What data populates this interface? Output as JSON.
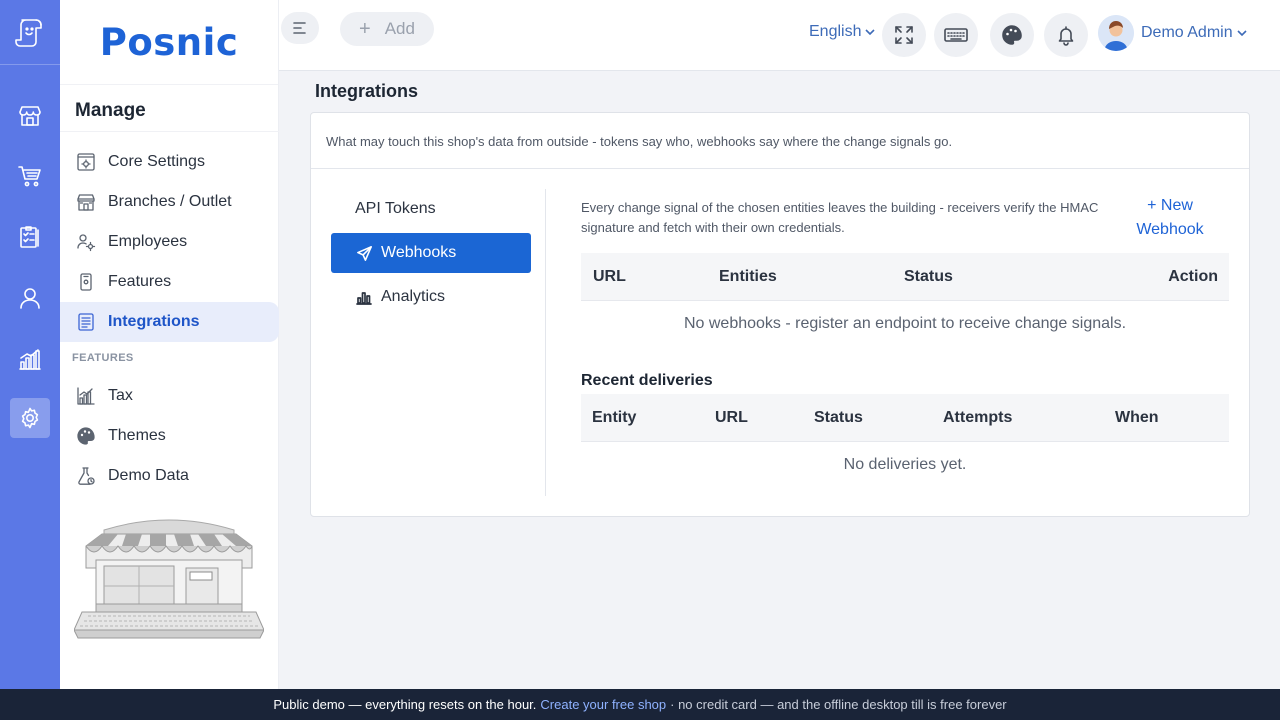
{
  "brand": {
    "name": "Posnic"
  },
  "rail": {
    "items": [
      {
        "icon": "store-icon"
      },
      {
        "icon": "cart-icon"
      },
      {
        "icon": "clipboard-icon"
      },
      {
        "icon": "user-icon"
      },
      {
        "icon": "chart-icon"
      },
      {
        "icon": "gear-icon",
        "active": true
      }
    ]
  },
  "sidebar": {
    "title": "Manage",
    "items": [
      {
        "label": "Core Settings",
        "icon": "settings-doc-icon"
      },
      {
        "label": "Branches / Outlet",
        "icon": "store-icon"
      },
      {
        "label": "Employees",
        "icon": "people-gear-icon"
      },
      {
        "label": "Features",
        "icon": "phone-icon"
      },
      {
        "label": "Integrations",
        "icon": "list-doc-icon",
        "active": true
      }
    ],
    "section_label": "FEATURES",
    "feature_items": [
      {
        "label": "Tax",
        "icon": "chart-icon"
      },
      {
        "label": "Themes",
        "icon": "palette-icon"
      },
      {
        "label": "Demo Data",
        "icon": "flask-icon"
      }
    ]
  },
  "topbar": {
    "add_label": "Add",
    "language": "English",
    "user_name": "Demo Admin",
    "icons": [
      "expand-icon",
      "keyboard-icon",
      "palette-icon",
      "bell-icon"
    ]
  },
  "main": {
    "title": "Integrations",
    "description": "What may touch this shop's data from outside - tokens say who, webhooks say where the change signals go.",
    "tabs": [
      {
        "label": "API Tokens"
      },
      {
        "label": "Webhooks",
        "active": true,
        "icon": "send-icon"
      },
      {
        "label": "Analytics",
        "icon": "bar-chart-icon"
      }
    ],
    "webhooks": {
      "description": "Every change signal of the chosen entities leaves the building - receivers verify the HMAC signature and fetch with their own credentials.",
      "new_button": "+ New Webhook",
      "columns": [
        "URL",
        "Entities",
        "Status",
        "Action"
      ],
      "empty": "No webhooks - register an endpoint to receive change signals."
    },
    "deliveries": {
      "title": "Recent deliveries",
      "columns": [
        "Entity",
        "URL",
        "Status",
        "Attempts",
        "When"
      ],
      "empty": "No deliveries yet."
    }
  },
  "footer": {
    "text1": "Public demo — everything resets on the hour.",
    "link": "Create your free shop",
    "text2": "· no credit card — and the offline desktop till is free forever"
  },
  "colors": {
    "rail": "#5b78e6",
    "brand": "#1e63d6",
    "active_tab": "#1b66d4",
    "footer": "#1a2438"
  }
}
